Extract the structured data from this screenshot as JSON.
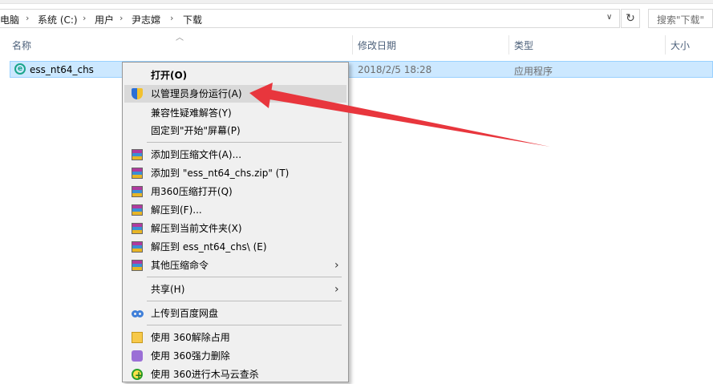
{
  "address": {
    "crumbs": [
      "电脑",
      "系统 (C:)",
      "用户",
      "尹志嫦",
      "下载"
    ],
    "search_placeholder": "搜索\"下载\""
  },
  "columns": {
    "name": "名称",
    "modified": "修改日期",
    "type": "类型",
    "size": "大小"
  },
  "file": {
    "name": "ess_nt64_chs",
    "modified": "2018/2/5 18:28",
    "type": "应用程序"
  },
  "menu": {
    "open": "打开(O)",
    "run_as_admin": "以管理员身份运行(A)",
    "compat": "兼容性疑难解答(Y)",
    "pin_start": "固定到\"开始\"屏幕(P)",
    "add_archive": "添加到压缩文件(A)...",
    "add_zip": "添加到 \"ess_nt64_chs.zip\" (T)",
    "open_360": "用360压缩打开(Q)",
    "extract_to": "解压到(F)...",
    "extract_here": "解压到当前文件夹(X)",
    "extract_folder": "解压到 ess_nt64_chs\\ (E)",
    "other_compress": "其他压缩命令",
    "share": "共享(H)",
    "baidu": "上传到百度网盘",
    "unlock_360": "使用 360解除占用",
    "force_delete_360": "使用 360强力删除",
    "scan_360": "使用 360进行木马云查杀"
  },
  "colors": {
    "selection": "#cce8ff",
    "arrow": "#e8363d",
    "menu_bg": "#f0f0f0"
  }
}
